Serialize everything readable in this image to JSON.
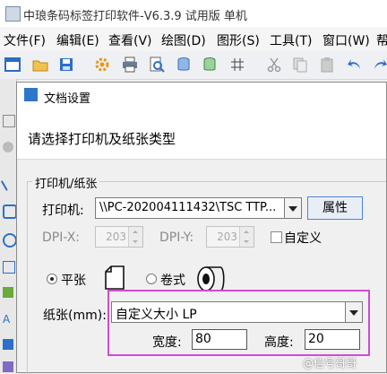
{
  "window": {
    "title": "中琅条码标签打印软件-V6.3.9 试用版 单机"
  },
  "menu": [
    "文件(F)",
    "编辑(E)",
    "查看(V)",
    "绘图(D)",
    "图形(S)",
    "工具(T)",
    "窗口(W)",
    "帮"
  ],
  "toolbar_icons": [
    "new-icon",
    "open-folder-icon",
    "save-icon",
    "settings-gear-icon",
    "print-icon",
    "print-preview-icon",
    "database-icon",
    "database-connect-icon",
    "grid-icon",
    "cut-icon",
    "copy-icon",
    "paste-icon",
    "undo-icon",
    "redo-icon"
  ],
  "dialog": {
    "title": "文档设置",
    "heading": "请选择打印机及纸张类型",
    "printer_group_label": "打印机/纸张",
    "printer_label": "打印机:",
    "printer_value": "\\\\PC-202004111432\\TSC TTP...",
    "properties_button": "属性",
    "dpi_x_label": "DPI-X:",
    "dpi_x_value": "203",
    "dpi_y_label": "DPI-Y:",
    "dpi_y_value": "203",
    "custom_label": "自定义",
    "radio_flat": "平张",
    "radio_roll": "卷式",
    "paper_label": "纸张(mm):",
    "paper_value": "自定义大小 LP",
    "width_label": "宽度:",
    "width_value": "80",
    "height_label": "高度:",
    "height_value": "20"
  },
  "watermark": "@信号哥哥",
  "colors": {
    "highlight": "#d24ad2",
    "accent": "#4c84d4"
  }
}
